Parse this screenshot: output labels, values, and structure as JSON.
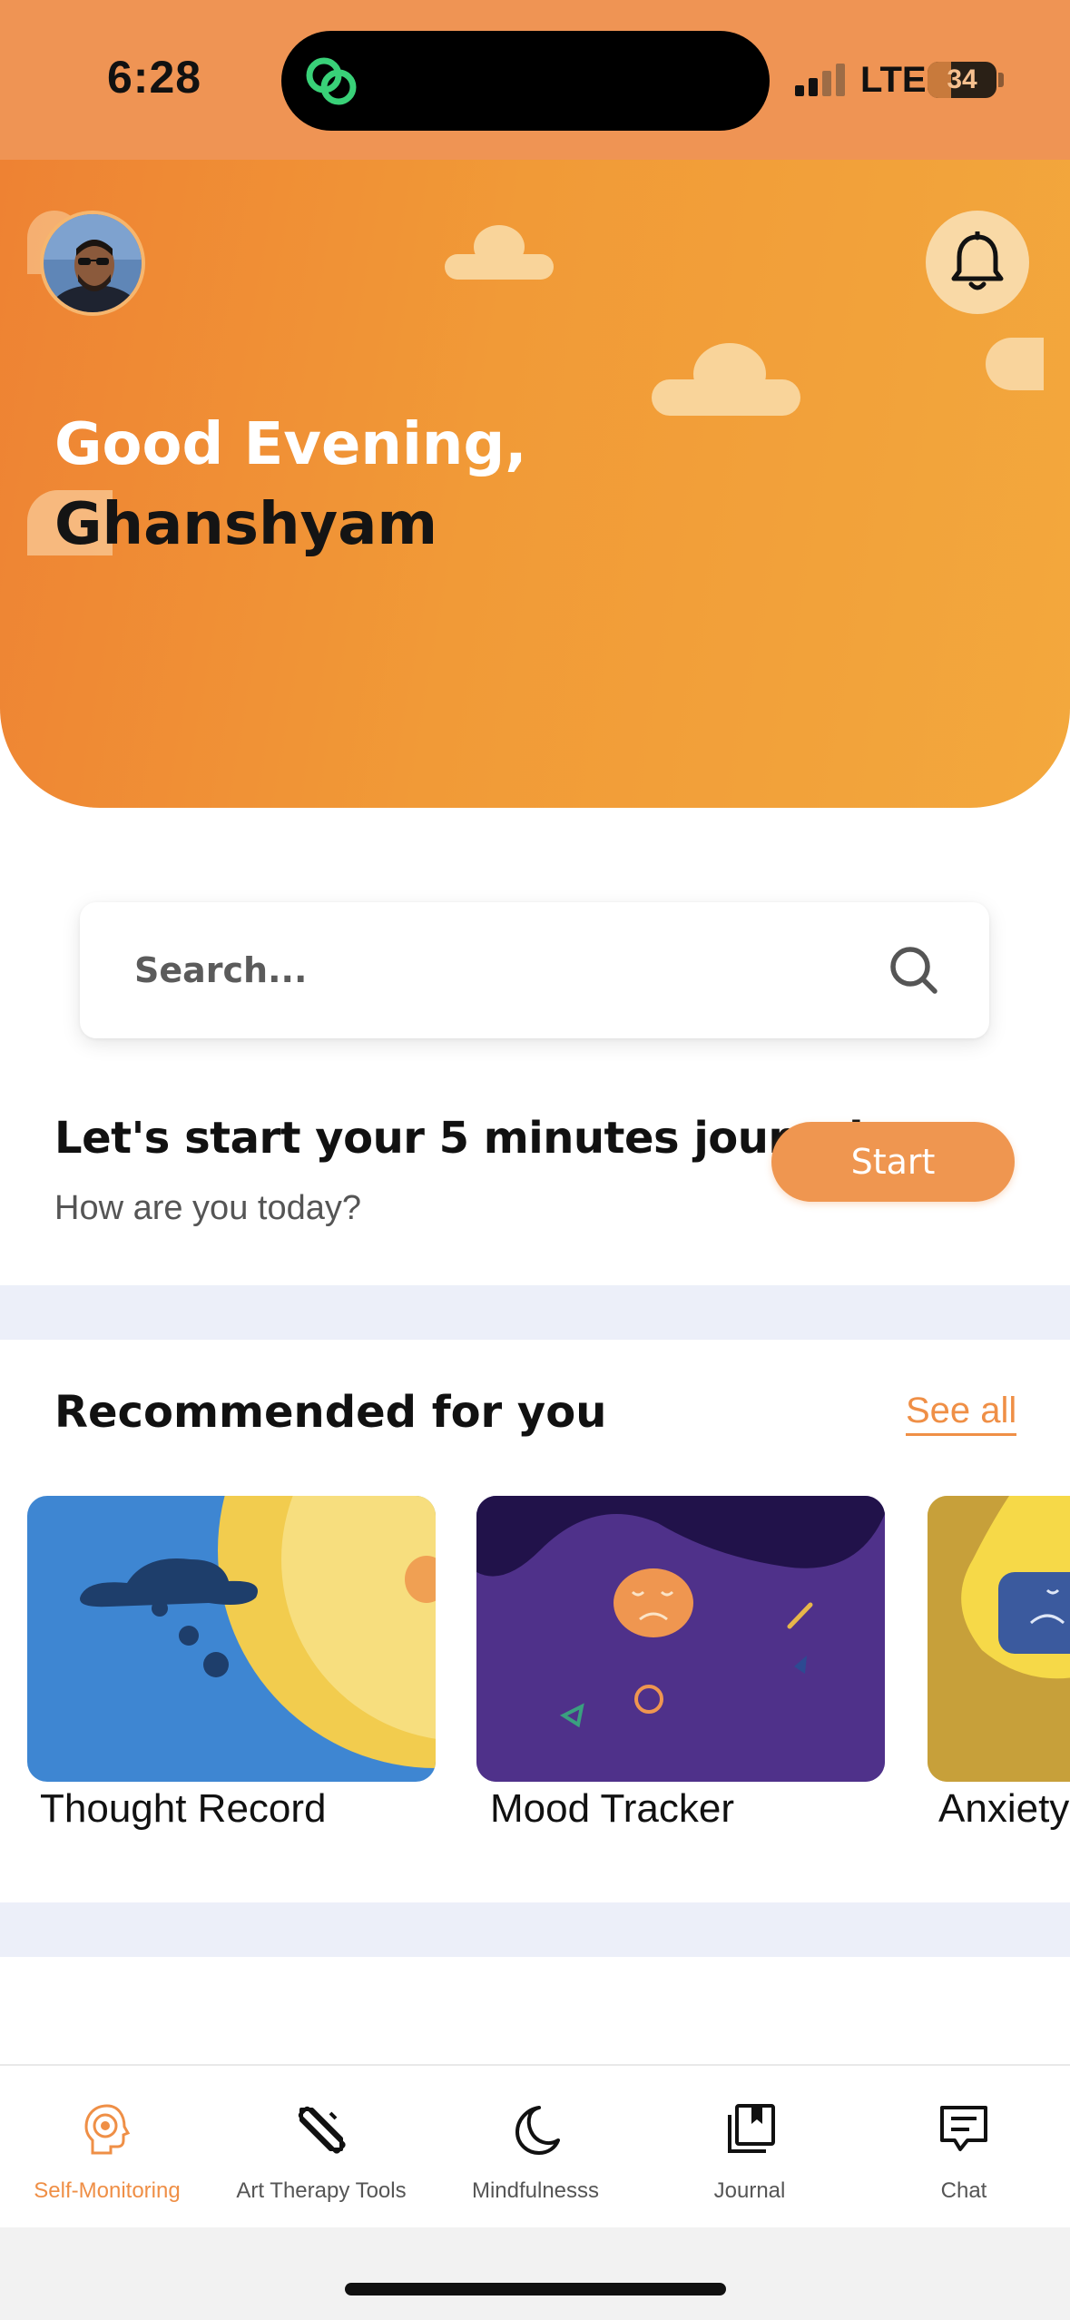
{
  "status_bar": {
    "time": "6:28",
    "network": "LTE",
    "battery": "34",
    "battery_level": 0.34
  },
  "header": {
    "greeting_line1": "Good Evening,",
    "greeting_line2": "Ghanshyam",
    "colors": {
      "start": "#ee8233",
      "end": "#f3a83d"
    }
  },
  "search": {
    "placeholder": "Search..."
  },
  "journal": {
    "title": "Let's start your 5 minutes journal",
    "subtitle": "How are you today?",
    "start_label": "Start"
  },
  "recommended": {
    "title": "Recommended for you",
    "see_all": "See all",
    "items": [
      {
        "label": "Thought Record",
        "color": "#3e86d2"
      },
      {
        "label": "Mood Tracker",
        "color": "#4f318a"
      },
      {
        "label": "Anxiety",
        "color": "#c7a03a"
      }
    ]
  },
  "tabs": [
    {
      "label": "Self-Monitoring",
      "icon": "head-brain-icon",
      "active": true
    },
    {
      "label": "Art Therapy Tools",
      "icon": "pencil-ruler-icon",
      "active": false
    },
    {
      "label": "Mindfulnesss",
      "icon": "moon-icon",
      "active": false
    },
    {
      "label": "Journal",
      "icon": "journal-book-icon",
      "active": false
    },
    {
      "label": "Chat",
      "icon": "chat-icon",
      "active": false
    }
  ],
  "accent_color": "#ef8f46"
}
